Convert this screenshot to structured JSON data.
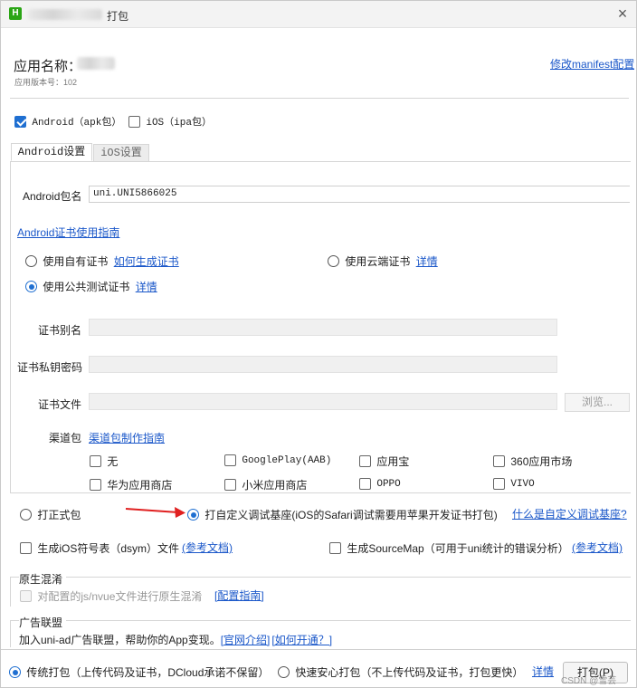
{
  "window": {
    "title_suffix": "打包",
    "close_glyph": "×"
  },
  "header": {
    "app_name_label": "应用名称：",
    "version_label": "应用版本号：102",
    "modify_manifest_link": "修改manifest配置"
  },
  "platforms": {
    "android_label": "Android（apk包）",
    "android_checked": true,
    "ios_label": "iOS（ipa包）",
    "ios_checked": false
  },
  "tabs": [
    {
      "label": "Android设置",
      "active": true
    },
    {
      "label": "iOS设置",
      "active": false
    }
  ],
  "android": {
    "package_label": "Android包名",
    "package_value": "uni.UNI5866025",
    "cert_guide_link": "Android证书使用指南",
    "cert_options": {
      "own_cert_label": "使用自有证书",
      "own_cert_link": "如何生成证书",
      "cloud_cert_label": "使用云端证书",
      "cloud_cert_link": "详情",
      "public_cert_label": "使用公共测试证书",
      "public_cert_link": "详情",
      "selected": "public"
    },
    "alias_label": "证书别名",
    "alias_value": "",
    "password_label": "证书私钥密码",
    "password_value": "",
    "file_label": "证书文件",
    "file_value": "",
    "browse_label": "浏览...",
    "channel_label": "渠道包",
    "channel_guide_link": "渠道包制作指南",
    "channels": [
      {
        "label": "无",
        "checked": false
      },
      {
        "label": "GooglePlay(AAB)",
        "checked": false
      },
      {
        "label": "应用宝",
        "checked": false
      },
      {
        "label": "360应用市场",
        "checked": false
      },
      {
        "label": "华为应用商店",
        "checked": false
      },
      {
        "label": "小米应用商店",
        "checked": false
      },
      {
        "label": "OPPO",
        "checked": false
      },
      {
        "label": "VIVO",
        "checked": false
      }
    ]
  },
  "package_type": {
    "release_label": "打正式包",
    "custom_base_label": "打自定义调试基座(iOS的Safari调试需要用苹果开发证书打包)",
    "custom_base_link": "什么是自定义调试基座?",
    "selected": "custom_base"
  },
  "extras": {
    "dsym_label": "生成iOS符号表（dsym）文件",
    "dsym_link": "(参考文档)",
    "sourcemap_label": "生成SourceMap（可用于uni统计的错误分析）",
    "sourcemap_link": "(参考文档)"
  },
  "obfuscation": {
    "title": "原生混淆",
    "option_label": "对配置的js/nvue文件进行原生混淆",
    "guide_link": "[配置指南]"
  },
  "ads": {
    "title": "广告联盟",
    "desc": "加入uni-ad广告联盟，帮助你的App变现。",
    "intro_link": "[官网介绍]",
    "howto_link": "[如何开通？]"
  },
  "footer": {
    "traditional_label": "传统打包（上传代码及证书，DCloud承诺不保留）",
    "fast_label": "快速安心打包（不上传代码及证书，打包更快）",
    "details_link": "详情",
    "pack_button": "打包(P)",
    "selected": "traditional",
    "watermark": "CSDN @雪芸"
  },
  "colors": {
    "accent": "#1f6fd1",
    "link": "#1a57c9",
    "arrow": "#e02020",
    "logo": "#2aa515"
  }
}
